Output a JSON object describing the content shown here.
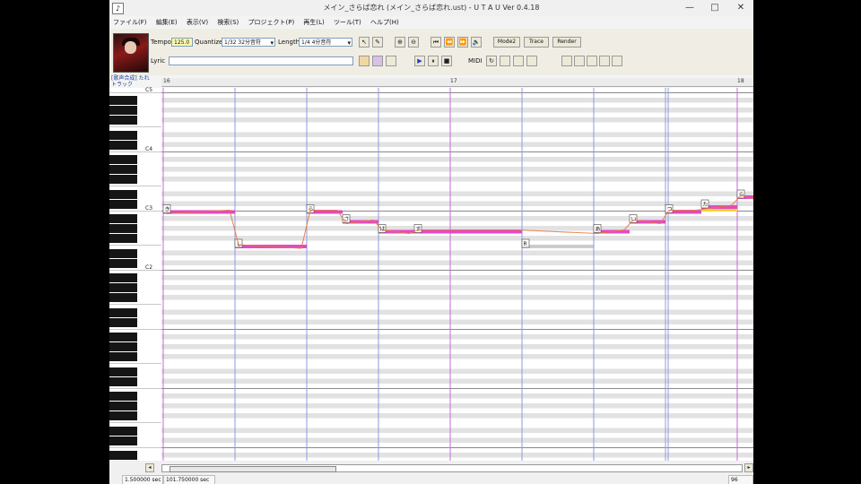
{
  "window": {
    "title": "メイン_さらば恋れ (メイン_さらば恋れ.ust) - U T A U Ver 0.4.18",
    "icon_glyph": "♪",
    "controls": {
      "minimize": "—",
      "maximize": "□",
      "close": "✕"
    }
  },
  "menu": [
    "ファイル(F)",
    "編集(E)",
    "表示(V)",
    "検索(S)",
    "プロジェクト(P)",
    "再生(L)",
    "ツール(T)",
    "ヘルプ(H)"
  ],
  "toolbar": {
    "tempo_label": "Tempo",
    "tempo_value": "125.0",
    "quantize_label": "Quantize",
    "quantize_value": "1/32 32分音符",
    "length_label": "Length",
    "length_value": "1/4 4分音符",
    "lyric_label": "Lyric",
    "lyric_value": "",
    "mode2_label": "Mode2",
    "trace_label": "Trace",
    "render_label": "Render",
    "midi_label": "MIDI",
    "icons": {
      "pointer": "↖",
      "pencil": "✎",
      "zoom_in": "⊕",
      "zoom_out": "⊖",
      "go_start": "⏮",
      "prev": "⏪",
      "next": "⏩",
      "speaker": "🔈",
      "play": "▶",
      "pause": "⏸",
      "stop": "■",
      "loop": "↻"
    }
  },
  "track": {
    "name": "[歌声合成] たれ",
    "sub": "トラック",
    "measures": [
      "16",
      "17",
      "18"
    ]
  },
  "keyboard": {
    "octave_labels": [
      "C5",
      "C4",
      "C3",
      "C2"
    ]
  },
  "colors": {
    "note_bar": "#e23fc3",
    "pitch_curve": "#e8743f",
    "measure_line": "#c86adc",
    "beat_line": "#8d9be0",
    "highlight": "#f2d23a"
  },
  "notes": [
    {
      "lyric": "き",
      "midi": 59.0,
      "start": 0.0,
      "len": 1.0
    },
    {
      "lyric": "し",
      "midi": 52.0,
      "start": 1.0,
      "len": 1.0
    },
    {
      "lyric": "ら",
      "midi": 59.0,
      "start": 2.0,
      "len": 0.5
    },
    {
      "lyric": "さ",
      "midi": 57.0,
      "start": 2.5,
      "len": 0.5
    },
    {
      "lyric": "は",
      "midi": 55.0,
      "start": 3.0,
      "len": 0.5
    },
    {
      "lyric": "す",
      "midi": 55.0,
      "start": 3.5,
      "len": 1.5
    },
    {
      "lyric": "R",
      "midi": 52.0,
      "start": 5.0,
      "len": 1.0,
      "rest": true
    },
    {
      "lyric": "あ",
      "midi": 55.0,
      "start": 6.0,
      "len": 0.5
    },
    {
      "lyric": "い",
      "midi": 57.0,
      "start": 6.5,
      "len": 0.5
    },
    {
      "lyric": "つ",
      "midi": 59.0,
      "start": 7.0,
      "len": 0.5
    },
    {
      "lyric": "た",
      "midi": 60.0,
      "start": 7.5,
      "len": 0.5
    },
    {
      "lyric": "ら",
      "midi": 62.0,
      "start": 8.0,
      "len": 0.3
    }
  ],
  "status": {
    "left": "1.500000 sec",
    "middle": "101.750000 sec",
    "right": "96"
  }
}
